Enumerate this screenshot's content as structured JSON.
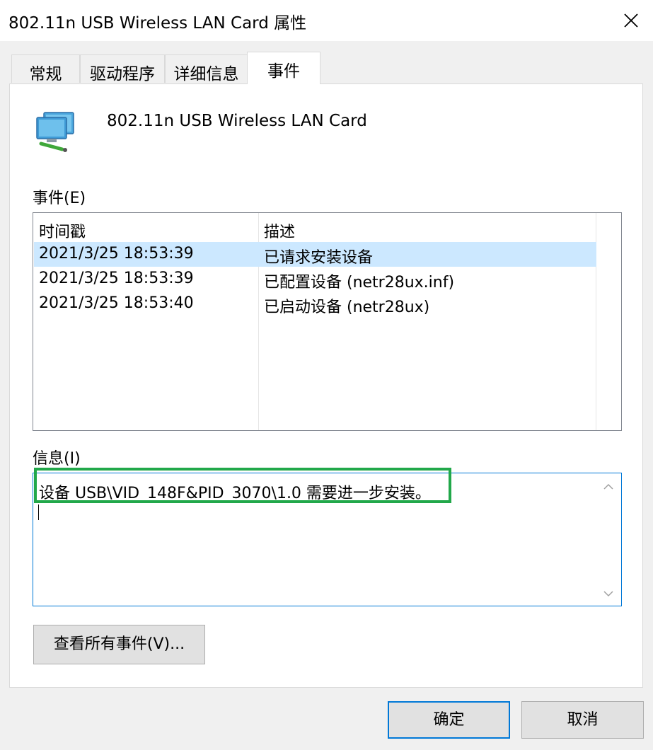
{
  "window": {
    "title": "802.11n USB Wireless LAN Card 属性"
  },
  "tabs": [
    {
      "label": "常规"
    },
    {
      "label": "驱动程序"
    },
    {
      "label": "详细信息"
    },
    {
      "label": "事件"
    }
  ],
  "device": {
    "name": "802.11n USB Wireless LAN Card",
    "icon": "network-adapter-icon"
  },
  "events": {
    "label": "事件(E)",
    "columns": [
      "时间戳",
      "描述"
    ],
    "rows": [
      {
        "timestamp": "2021/3/25 18:53:39",
        "description": "已请求安装设备"
      },
      {
        "timestamp": "2021/3/25 18:53:39",
        "description": "已配置设备 (netr28ux.inf)"
      },
      {
        "timestamp": "2021/3/25 18:53:40",
        "description": "已启动设备 (netr28ux)"
      }
    ]
  },
  "info": {
    "label": "信息(I)",
    "text": "设备 USB\\VID_148F&PID_3070\\1.0 需要进一步安装。"
  },
  "buttons": {
    "view_all_events": "查看所有事件(V)...",
    "ok": "确定",
    "cancel": "取消"
  },
  "colors": {
    "selection": "#cce8ff",
    "focus_border": "#0078d7",
    "highlight_box": "#22a84a"
  }
}
